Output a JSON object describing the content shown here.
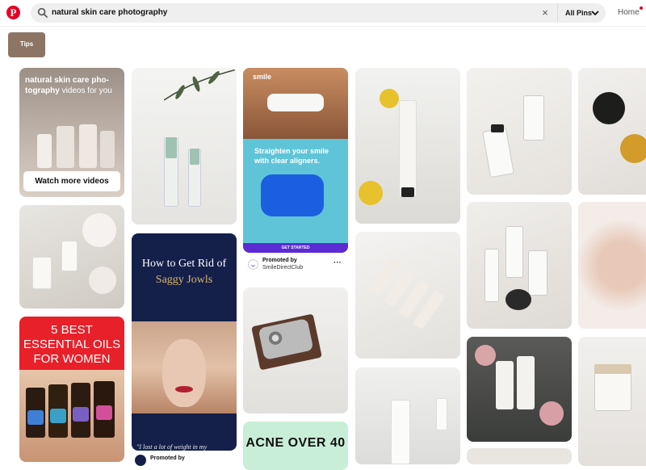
{
  "header": {
    "search_query": "natural skin care photography",
    "filter_label": "All Pins",
    "home_label": "Home"
  },
  "tips_label": "Tips",
  "video_card": {
    "title_bold": "natural skin care pho-tography",
    "title_rest": "videos for you",
    "button_label": "Watch more videos"
  },
  "oils_card": {
    "line1": "5 BEST",
    "line2": "ESSENTIAL OILS",
    "line3": "FOR WOMEN"
  },
  "jowls_card": {
    "line1": "How to Get Rid of",
    "line2": "Saggy Jowls",
    "quote": "\"I lost a lot of weight in my",
    "promoted": "Promoted by"
  },
  "smile_card": {
    "brand": "smile",
    "headline": "Straighten your smile with clear aligners.",
    "cta": "GET STARTED",
    "promoted": "Promoted by",
    "advertiser": "SmileDirectClub",
    "more": "···"
  },
  "acne_card": {
    "text": "ACNE OVER 40"
  },
  "colors": {
    "brand_red": "#e60023",
    "tips_bg": "#8d7566",
    "smile_cta": "#5b2bd4"
  }
}
